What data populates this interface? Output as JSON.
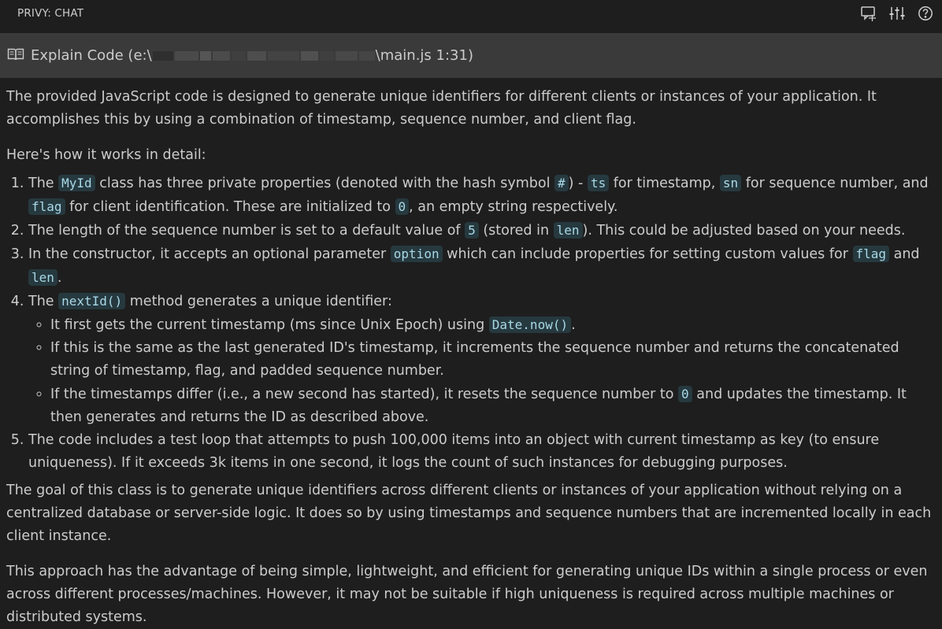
{
  "panel": {
    "title": "PRIVY: CHAT",
    "icons": [
      "new-chat-icon",
      "settings-sliders-icon",
      "help-icon"
    ]
  },
  "conversation": {
    "header_prefix": "Explain Code (e:\\",
    "header_suffix": "\\main.js 1:31)"
  },
  "response": {
    "intro": "The provided JavaScript code is designed to generate unique identifiers for different clients or instances of your application. It accomplishes this by using a combination of timestamp, sequence number, and client flag.",
    "how_heading": "Here's how it works in detail:",
    "item1": {
      "t1": "The ",
      "c1": "MyId",
      "t2": " class has three private properties (denoted with the hash symbol ",
      "c2": "#",
      "t3": ") - ",
      "c3": "ts",
      "t4": " for timestamp, ",
      "c4": "sn",
      "t5": " for sequence number, and ",
      "c5": "flag",
      "t6": " for client identification. These are initialized to ",
      "c6": "0",
      "t7": ", an empty string respectively."
    },
    "item2": {
      "t1": "The length of the sequence number is set to a default value of ",
      "c1": "5",
      "t2": " (stored in ",
      "c2": "len",
      "t3": "). This could be adjusted based on your needs."
    },
    "item3": {
      "t1": "In the constructor, it accepts an optional parameter ",
      "c1": "option",
      "t2": " which can include properties for setting custom values for ",
      "c2": "flag",
      "t3": " and ",
      "c3": "len",
      "t4": "."
    },
    "item4": {
      "t1": "The ",
      "c1": "nextId()",
      "t2": " method generates a unique identifier:",
      "sub1": {
        "t1": "It first gets the current timestamp (ms since Unix Epoch) using ",
        "c1": "Date.now()",
        "t2": "."
      },
      "sub2": "If this is the same as the last generated ID's timestamp, it increments the sequence number and returns the concatenated string of timestamp, flag, and padded sequence number.",
      "sub3": {
        "t1": "If the timestamps differ (i.e., a new second has started), it resets the sequence number to ",
        "c1": "0",
        "t2": " and updates the timestamp. It then generates and returns the ID as described above."
      }
    },
    "item5": "The code includes a test loop that attempts to push 100,000 items into an object with current timestamp as key (to ensure uniqueness). If it exceeds 3k items in one second, it logs the count of such instances for debugging purposes.",
    "goal": "The goal of this class is to generate unique identifiers across different clients or instances of your application without relying on a centralized database or server-side logic. It does so by using timestamps and sequence numbers that are incremented locally in each client instance.",
    "approach": "This approach has the advantage of being simple, lightweight, and efficient for generating unique IDs within a single process or even across different processes/machines. However, it may not be suitable if high uniqueness is required across multiple machines or distributed systems."
  }
}
